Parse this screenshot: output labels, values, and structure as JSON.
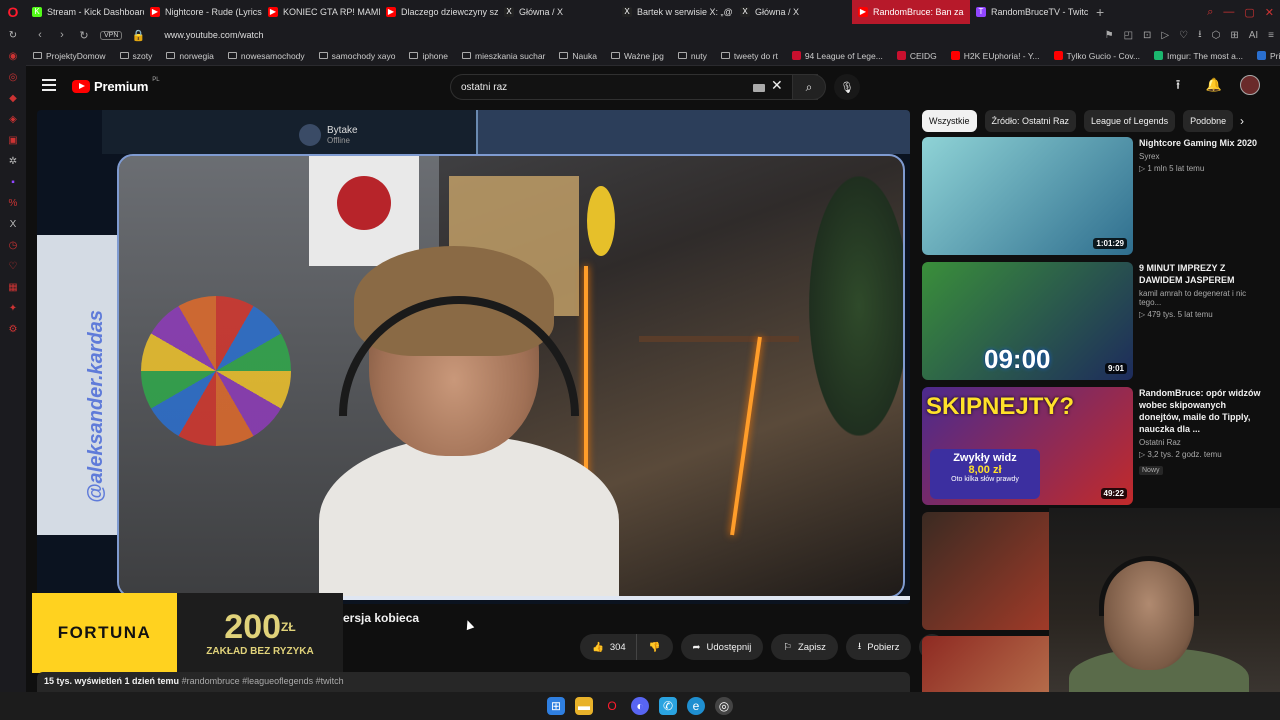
{
  "browser": {
    "tabs": [
      {
        "label": "Stream - Kick Dashboard",
        "color": "#53fc18",
        "glyph": "K"
      },
      {
        "label": "Nightcore - Rude (Lyrics)",
        "color": "#ff0000",
        "glyph": "▶"
      },
      {
        "label": "KONIEC GTA RP! MAMMO",
        "color": "#ff0000",
        "glyph": "▶"
      },
      {
        "label": "Dlaczego dziewczyny szan",
        "color": "#ff0000",
        "glyph": "▶"
      },
      {
        "label": "Główna / X",
        "color": "#222222",
        "glyph": "X"
      },
      {
        "label": "Bartek w serwisie X: „@ D",
        "color": "#222222",
        "glyph": "X"
      },
      {
        "label": "Główna / X",
        "color": "#222222",
        "glyph": "X"
      },
      {
        "label": "RandomBruce: Ban za",
        "color": "#ff0000",
        "glyph": "▶",
        "active": true
      },
      {
        "label": "RandomBruceTV - Twitch",
        "color": "#9146ff",
        "glyph": "T"
      }
    ],
    "url": "www.youtube.com/watch",
    "vpn": "VPN",
    "bookmarks": [
      {
        "label": "ProjektyDomow",
        "type": "folder"
      },
      {
        "label": "szoty",
        "type": "folder"
      },
      {
        "label": "norwegia",
        "type": "folder"
      },
      {
        "label": "nowesamochody",
        "type": "folder"
      },
      {
        "label": "samochody xayo",
        "type": "folder"
      },
      {
        "label": "iphone",
        "type": "folder"
      },
      {
        "label": "mieszkania suchar",
        "type": "folder"
      },
      {
        "label": "Nauka",
        "type": "folder"
      },
      {
        "label": "Ważne jpg",
        "type": "folder"
      },
      {
        "label": "nuty",
        "type": "folder"
      },
      {
        "label": "tweety do rt",
        "type": "folder"
      },
      {
        "label": "94 League of Lege...",
        "type": "site",
        "color": "#c8102e"
      },
      {
        "label": "CEIDG",
        "type": "site",
        "color": "#c8102e"
      },
      {
        "label": "H2K EUphoria! - Y...",
        "type": "site",
        "color": "#ff0000"
      },
      {
        "label": "Tylko Gucio - Cov...",
        "type": "site",
        "color": "#ff0000"
      },
      {
        "label": "Imgur: The most a...",
        "type": "site",
        "color": "#1bb76e"
      },
      {
        "label": "Price history, price...",
        "type": "site",
        "color": "#2a6fcf"
      }
    ]
  },
  "youtube": {
    "logo_text": "Premium",
    "logo_country": "PL",
    "search_value": "ostatni raz",
    "video": {
      "stream_name": "Bytake",
      "stream_status": "Offline",
      "side_handle": "@aleksander.kardas",
      "title_fragment": "ersja kobieca",
      "progress": 1.0,
      "likes": "304",
      "share_label": "Udostępnij",
      "save_label": "Zapisz",
      "download_label": "Pobierz",
      "views_line": "15 tys. wyświetleń  1 dzień temu",
      "tags": "#randombruce #leagueoflegends #twitch"
    },
    "ad": {
      "brand": "FORTUNA",
      "amount": "200",
      "currency": "ZŁ",
      "promo": "ZAKŁAD BEZ RYZYKA"
    },
    "chips": [
      "Wszystkie",
      "Źródło: Ostatni Raz",
      "League of Legends",
      "Podobne"
    ],
    "recommendations": [
      {
        "title": "Nightcore Gaming Mix 2020",
        "channel": "Syrex",
        "stats": "▷ 1 mln  5 lat temu",
        "duration": "1:01:29",
        "thumb_a": "#8fd3d6",
        "thumb_b": "#2f6e8e"
      },
      {
        "title": "9 MINUT IMPREZY Z DAWIDEM JASPEREM",
        "channel": "kamil amrah to degenerat i nic tego...",
        "stats": "▷ 479 tys.  5 lat temu",
        "duration": "9:01",
        "thumb_a": "#3a8f3a",
        "thumb_b": "#1d2b5c"
      },
      {
        "title": "RandomBruce: opór widzów wobec skipowanych donejtów, maile do Tipply, nauczka dla ...",
        "channel": "Ostatni Raz",
        "stats": "▷ 3,2 tys.  2 godz. temu",
        "duration": "49:22",
        "badge": "Nowy",
        "thumb_a": "#4b2a8e",
        "thumb_b": "#c22a2a"
      },
      {
        "title": "",
        "channel": "",
        "stats": "",
        "duration": "",
        "thumb_a": "#3a2a22",
        "thumb_b": "#c2402a"
      },
      {
        "title": "",
        "channel": "",
        "stats": "",
        "duration": "",
        "thumb_a": "#8e2a22",
        "thumb_b": "#d4a06a"
      }
    ],
    "rec1_thumb_text": "",
    "rec2_timer": "09:00",
    "rec3_thumb_title": "SKIPNEJTY?",
    "rec3_card_title": "Zwykły widz",
    "rec3_card_amount": "8,00 zł",
    "rec3_card_sub": "Oto kilka słów prawdy"
  }
}
